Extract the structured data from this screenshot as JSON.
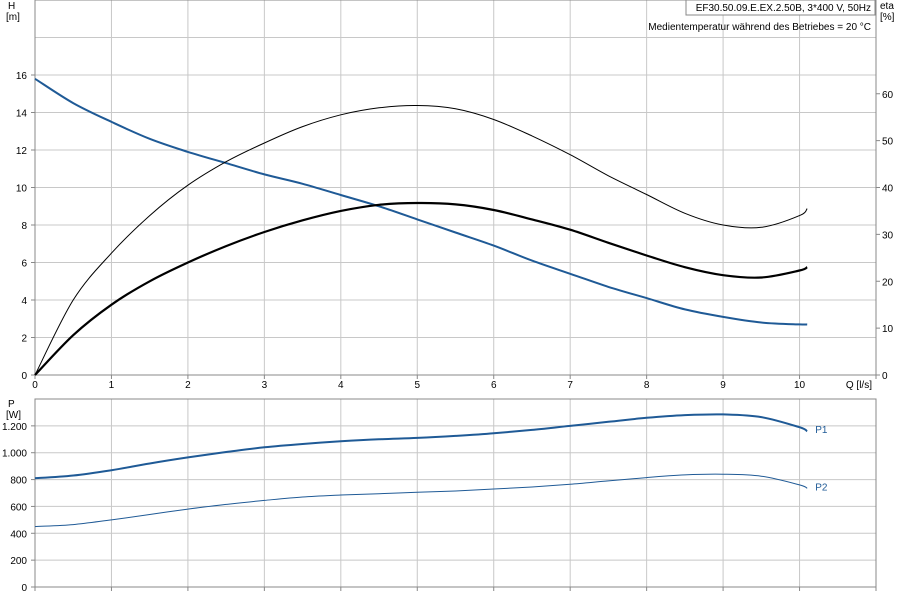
{
  "header": {
    "model": "EF30.50.09.E.EX.2.50B, 3*400 V, 50Hz",
    "note": "Medientemperatur während des Betriebes = 20 °C"
  },
  "colors": {
    "blue": "#1f5a96",
    "black": "#000000",
    "grid": "#c8c8c8"
  },
  "chart_data": [
    {
      "type": "line",
      "xlabel": "Q [l/s]",
      "ylabel_line1": "H",
      "ylabel_line2": "[m]",
      "y2label_line1": "eta",
      "y2label_line2": "[%]",
      "xlim": [
        0,
        11
      ],
      "ylim": [
        0,
        20
      ],
      "y2lim": [
        0,
        80
      ],
      "xticks": [
        0,
        1,
        2,
        3,
        4,
        5,
        6,
        7,
        8,
        9,
        10,
        11
      ],
      "xticklabels": [
        "0",
        "1",
        "2",
        "3",
        "4",
        "5",
        "6",
        "7",
        "8",
        "9",
        "10",
        "Q [l/s]"
      ],
      "yticks": [
        0,
        2,
        4,
        6,
        8,
        10,
        12,
        14,
        16
      ],
      "yticklabels": [
        "0",
        "2",
        "4",
        "6",
        "8",
        "10",
        "12",
        "14",
        "16"
      ],
      "y2ticks": [
        0,
        10,
        20,
        30,
        40,
        50,
        60
      ],
      "y2ticklabels": [
        "0",
        "10",
        "20",
        "30",
        "40",
        "50",
        "60"
      ],
      "grid": true,
      "series": [
        {
          "axis": "left",
          "color": "#1f5a96",
          "width": 2,
          "x": [
            0,
            0.5,
            1,
            1.5,
            2,
            2.5,
            3,
            3.5,
            4,
            4.5,
            5,
            5.5,
            6,
            6.5,
            7,
            7.5,
            8,
            8.5,
            9,
            9.5,
            10,
            10.1
          ],
          "y": [
            15.8,
            14.5,
            13.5,
            12.6,
            11.9,
            11.3,
            10.7,
            10.2,
            9.6,
            9.0,
            8.3,
            7.6,
            6.9,
            6.1,
            5.4,
            4.7,
            4.1,
            3.5,
            3.1,
            2.8,
            2.7,
            2.7
          ]
        },
        {
          "axis": "right",
          "color": "#000000",
          "width": 1,
          "x": [
            0,
            0.5,
            1,
            1.5,
            2,
            2.5,
            3,
            3.5,
            4,
            4.5,
            5,
            5.5,
            6,
            6.5,
            7,
            7.5,
            8,
            8.5,
            9,
            9.5,
            10,
            10.1
          ],
          "y": [
            0,
            16,
            26,
            34,
            40.5,
            45.5,
            49.5,
            53,
            55.5,
            57,
            57.5,
            56.8,
            54.5,
            51,
            47,
            42.5,
            38.5,
            34.5,
            32,
            31.5,
            34,
            35.5
          ]
        },
        {
          "axis": "right",
          "color": "#000000",
          "width": 2.2,
          "x": [
            0,
            0.5,
            1,
            1.5,
            2,
            2.5,
            3,
            3.5,
            4,
            4.5,
            5,
            5.5,
            6,
            6.5,
            7,
            7.5,
            8,
            8.5,
            9,
            9.5,
            10,
            10.1
          ],
          "y": [
            0,
            8.5,
            15,
            20,
            24,
            27.5,
            30.5,
            33,
            35,
            36.3,
            36.7,
            36.4,
            35.2,
            33.2,
            31,
            28.2,
            25.5,
            23,
            21.3,
            20.8,
            22.3,
            23
          ]
        }
      ]
    },
    {
      "type": "line",
      "xlim": [
        0,
        11
      ],
      "ylim": [
        0,
        1400
      ],
      "ylabel_line1": "P",
      "ylabel_line2": "[W]",
      "yticks": [
        0,
        200,
        400,
        600,
        800,
        1000,
        1200
      ],
      "yticklabels": [
        "0",
        "200",
        "400",
        "600",
        "800",
        "1.000",
        "1.200"
      ],
      "grid": true,
      "series": [
        {
          "name": "P1",
          "color": "#1f5a96",
          "width": 2,
          "x": [
            0,
            0.5,
            1,
            1.5,
            2,
            2.5,
            3,
            3.5,
            4,
            4.5,
            5,
            5.5,
            6,
            6.5,
            7,
            7.5,
            8,
            8.5,
            9,
            9.5,
            10,
            10.1
          ],
          "y": [
            810,
            830,
            870,
            920,
            965,
            1005,
            1040,
            1065,
            1085,
            1100,
            1110,
            1125,
            1145,
            1170,
            1200,
            1230,
            1260,
            1280,
            1285,
            1265,
            1190,
            1160
          ]
        },
        {
          "name": "P2",
          "color": "#1f5a96",
          "width": 1,
          "x": [
            0,
            0.5,
            1,
            1.5,
            2,
            2.5,
            3,
            3.5,
            4,
            4.5,
            5,
            5.5,
            6,
            6.5,
            7,
            7.5,
            8,
            8.5,
            9,
            9.5,
            10,
            10.1
          ],
          "y": [
            450,
            465,
            500,
            540,
            580,
            615,
            645,
            670,
            685,
            695,
            705,
            715,
            730,
            745,
            765,
            790,
            815,
            835,
            840,
            825,
            760,
            735
          ]
        }
      ]
    }
  ]
}
